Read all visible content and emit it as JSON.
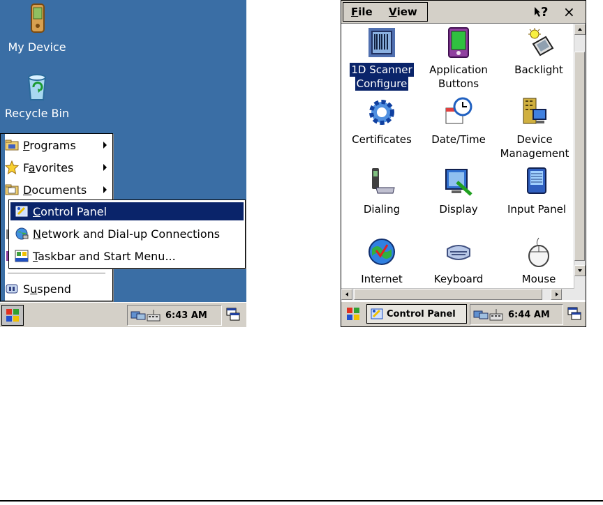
{
  "left": {
    "desktop_icons": [
      {
        "label": "My Device",
        "icon": "pda-device-icon"
      },
      {
        "label": "Recycle Bin",
        "icon": "recycle-bin-icon"
      }
    ],
    "start_menu": [
      {
        "prefix": "",
        "accel": "P",
        "rest": "rograms",
        "icon": "folder-programs-icon",
        "submenu": true
      },
      {
        "prefix": "F",
        "accel": "a",
        "rest": "vorites",
        "icon": "star-icon",
        "submenu": true
      },
      {
        "prefix": "",
        "accel": "D",
        "rest": "ocuments",
        "icon": "folder-documents-icon",
        "submenu": true
      },
      {
        "prefix": "S",
        "accel": "u",
        "rest": "spend",
        "icon": "suspend-icon",
        "submenu": false
      }
    ],
    "settings_submenu": [
      {
        "prefix": "",
        "accel": "C",
        "rest": "ontrol Panel",
        "icon": "control-panel-icon",
        "selected": true
      },
      {
        "prefix": "",
        "accel": "N",
        "rest": "etwork and Dial-up Connections",
        "icon": "network-globe-icon",
        "selected": false
      },
      {
        "prefix": "",
        "accel": "T",
        "rest": "askbar and Start Menu...",
        "icon": "taskbar-icon",
        "selected": false
      }
    ],
    "taskbar": {
      "clock": "6:43 AM"
    }
  },
  "right": {
    "menubar": {
      "file_accel": "F",
      "file_rest": "ile",
      "view_accel": "V",
      "view_rest": "iew",
      "help_label": "?",
      "close_label": "×"
    },
    "items": [
      {
        "line1": "1D Scanner",
        "line2": "Configure",
        "icon": "scanner-icon",
        "selected": true
      },
      {
        "line1": "Application",
        "line2": "Buttons",
        "icon": "pda-green-icon",
        "selected": false
      },
      {
        "line1": "Backlight",
        "line2": "",
        "icon": "backlight-icon",
        "selected": false
      },
      {
        "line1": "Certificates",
        "line2": "",
        "icon": "gear-certificate-icon",
        "selected": false
      },
      {
        "line1": "Date/Time",
        "line2": "",
        "icon": "calendar-clock-icon",
        "selected": false
      },
      {
        "line1": "Device",
        "line2": "Management",
        "icon": "device-management-icon",
        "selected": false
      },
      {
        "line1": "Dialing",
        "line2": "",
        "icon": "phone-modem-icon",
        "selected": false
      },
      {
        "line1": "Display",
        "line2": "",
        "icon": "display-monitor-icon",
        "selected": false
      },
      {
        "line1": "Input Panel",
        "line2": "",
        "icon": "input-panel-icon",
        "selected": false
      },
      {
        "line1": "Internet",
        "line2": "",
        "icon": "internet-globe-icon",
        "selected": false
      },
      {
        "line1": "Keyboard",
        "line2": "",
        "icon": "keyboard-icon",
        "selected": false
      },
      {
        "line1": "Mouse",
        "line2": "",
        "icon": "mouse-icon",
        "selected": false
      }
    ],
    "taskbar": {
      "task_label": "Control Panel",
      "clock": "6:44 AM"
    }
  }
}
